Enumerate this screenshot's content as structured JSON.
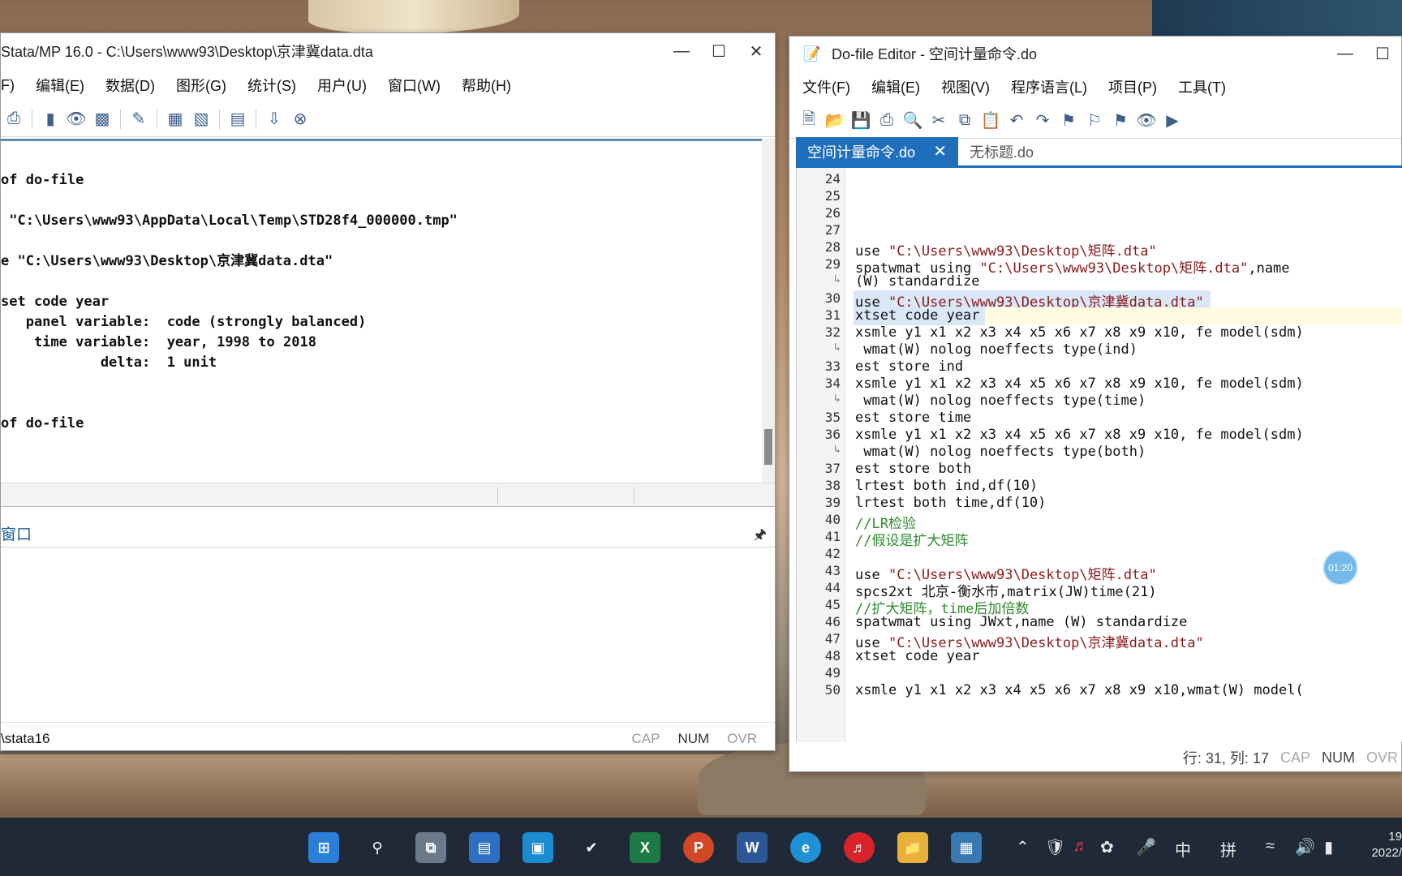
{
  "stata": {
    "title": "Stata/MP 16.0 - C:\\Users\\www93\\Desktop\\京津冀data.dta",
    "menu": [
      "F)",
      "编辑(E)",
      "数据(D)",
      "图形(G)",
      "统计(S)",
      "用户(U)",
      "窗口(W)",
      "帮助(H)"
    ],
    "results_lines": [
      "of do-file",
      "",
      " \"C:\\Users\\www93\\AppData\\Local\\Temp\\STD28f4_000000.tmp\"",
      "",
      "e \"C:\\Users\\www93\\Desktop\\京津冀data.dta\"",
      "",
      "set code year",
      "   panel variable:  code (strongly balanced)",
      "    time variable:  year, 1998 to 2018",
      "            delta:  1 unit",
      "",
      "",
      "of do-file"
    ],
    "command_window_title": "窗口",
    "status_path": "\\stata16",
    "status_flags": [
      "CAP",
      "NUM",
      "OVR"
    ]
  },
  "editor": {
    "title": "Do-file Editor - 空间计量命令.do",
    "menu": [
      "文件(F)",
      "编辑(E)",
      "视图(V)",
      "程序语言(L)",
      "项目(P)",
      "工具(T)"
    ],
    "tabs": [
      {
        "label": "空间计量命令.do",
        "active": true
      },
      {
        "label": "无标题.do",
        "active": false
      }
    ],
    "lines": [
      {
        "n": "24",
        "text": ""
      },
      {
        "n": "25",
        "text": ""
      },
      {
        "n": "26",
        "text": ""
      },
      {
        "n": "27",
        "text": ""
      },
      {
        "n": "28",
        "pre": "use ",
        "str": "\"C:\\Users\\www93\\Desktop\\矩阵.dta\"",
        "post": ""
      },
      {
        "n": "29",
        "pre": "spatwmat using ",
        "str": "\"C:\\Users\\www93\\Desktop\\矩阵.dta\"",
        "post": ",name"
      },
      {
        "n": "↳",
        "text": "(W) standardize"
      },
      {
        "n": "30",
        "pre": "use ",
        "str": "\"C:\\Users\\www93\\Desktop\\京津冀data.dta\"",
        "post": ""
      },
      {
        "n": "31",
        "text": "xtset code year"
      },
      {
        "n": "32",
        "text": "xsmle y1 x1 x2 x3 x4 x5 x6 x7 x8 x9 x10, fe model(sdm)"
      },
      {
        "n": "↳",
        "text": " wmat(W) nolog noeffects type(ind)"
      },
      {
        "n": "33",
        "text": "est store ind"
      },
      {
        "n": "34",
        "text": "xsmle y1 x1 x2 x3 x4 x5 x6 x7 x8 x9 x10, fe model(sdm)"
      },
      {
        "n": "↳",
        "text": " wmat(W) nolog noeffects type(time)"
      },
      {
        "n": "35",
        "text": "est store time"
      },
      {
        "n": "36",
        "text": "xsmle y1 x1 x2 x3 x4 x5 x6 x7 x8 x9 x10, fe model(sdm)"
      },
      {
        "n": "↳",
        "text": " wmat(W) nolog noeffects type(both)"
      },
      {
        "n": "37",
        "text": "est store both"
      },
      {
        "n": "38",
        "text": "lrtest both ind,df(10)"
      },
      {
        "n": "39",
        "text": "lrtest both time,df(10)"
      },
      {
        "n": "40",
        "cmt": "//LR检验"
      },
      {
        "n": "41",
        "cmt": "//假设是扩大矩阵"
      },
      {
        "n": "42",
        "text": ""
      },
      {
        "n": "43",
        "pre": "use ",
        "str": "\"C:\\Users\\www93\\Desktop\\矩阵.dta\"",
        "post": ""
      },
      {
        "n": "44",
        "text": "spcs2xt 北京-衡水市,matrix(JW)time(21)"
      },
      {
        "n": "45",
        "cmt": "//扩大矩阵，time后加倍数"
      },
      {
        "n": "46",
        "text": "spatwmat using JWxt,name (W) standardize"
      },
      {
        "n": "47",
        "pre": "use ",
        "str": "\"C:\\Users\\www93\\Desktop\\京津冀data.dta\"",
        "post": ""
      },
      {
        "n": "48",
        "text": "xtset code year"
      },
      {
        "n": "49",
        "text": ""
      },
      {
        "n": "50",
        "text": "xsmle y1 x1 x2 x3 x4 x5 x6 x7 x8 x9 x10,wmat(W) model("
      }
    ],
    "status_position": "行: 31, 列: 17",
    "status_flags": [
      "CAP",
      "NUM",
      "OVR"
    ]
  },
  "timer": "01:20",
  "taskbar": {
    "tray_lang": "中",
    "tray_ime": "拼",
    "clock_time": "19",
    "clock_date": "2022/"
  }
}
